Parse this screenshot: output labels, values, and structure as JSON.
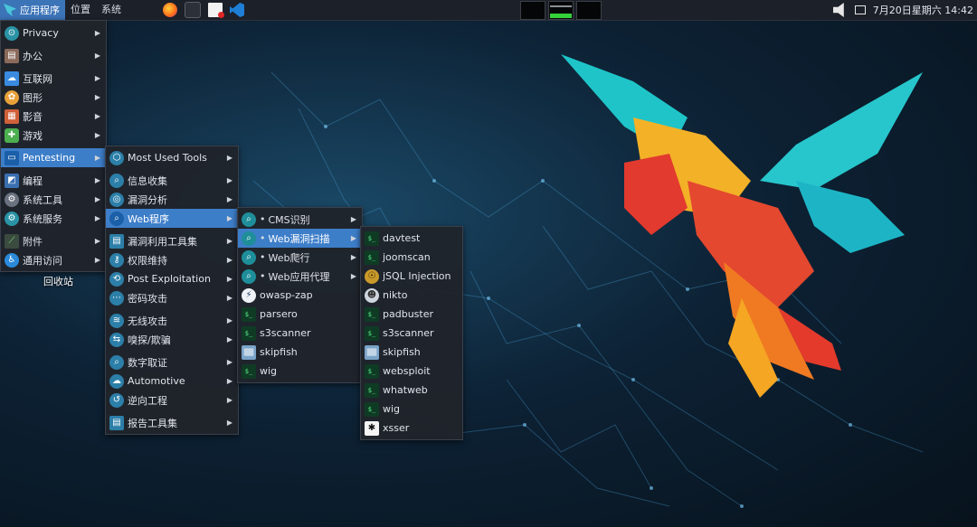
{
  "topbar": {
    "app_menu_label": "应用程序",
    "places_label": "位置",
    "system_label": "系统",
    "clock": "7月20日星期六 14:42"
  },
  "desktop": {
    "trash_label": "回收站"
  },
  "menus": {
    "main": [
      {
        "label": "Privacy",
        "icon": "privacy-icon"
      },
      {
        "label": "办公",
        "icon": "office-icon"
      },
      {
        "label": "互联网",
        "icon": "internet-icon"
      },
      {
        "label": "图形",
        "icon": "graphics-icon"
      },
      {
        "label": "影音",
        "icon": "multimedia-icon"
      },
      {
        "label": "游戏",
        "icon": "games-icon"
      },
      {
        "label": "Pentesting",
        "icon": "pentesting-icon"
      },
      {
        "label": "编程",
        "icon": "programming-icon"
      },
      {
        "label": "系统工具",
        "icon": "system-tools-icon"
      },
      {
        "label": "系统服务",
        "icon": "system-services-icon"
      },
      {
        "label": "附件",
        "icon": "accessories-icon"
      },
      {
        "label": "通用访问",
        "icon": "accessibility-icon"
      }
    ],
    "pentesting": [
      {
        "label": "Most Used Tools"
      },
      {
        "label": "信息收集"
      },
      {
        "label": "漏洞分析"
      },
      {
        "label": "Web程序"
      },
      {
        "label": "漏洞利用工具集"
      },
      {
        "label": "权限维持"
      },
      {
        "label": "Post Exploitation"
      },
      {
        "label": "密码攻击"
      },
      {
        "label": "无线攻击"
      },
      {
        "label": "嗅探/欺骗"
      },
      {
        "label": "数字取证"
      },
      {
        "label": "Automotive"
      },
      {
        "label": "逆向工程"
      },
      {
        "label": "报告工具集"
      }
    ],
    "web": [
      {
        "label": "CMS识别"
      },
      {
        "label": "Web漏洞扫描"
      },
      {
        "label": "Web爬行"
      },
      {
        "label": "Web应用代理"
      },
      {
        "label": "owasp-zap"
      },
      {
        "label": "parsero"
      },
      {
        "label": "s3scanner"
      },
      {
        "label": "skipfish"
      },
      {
        "label": "wig"
      }
    ],
    "vuln_scan": [
      {
        "label": "davtest"
      },
      {
        "label": "joomscan"
      },
      {
        "label": "jSQL Injection"
      },
      {
        "label": "nikto"
      },
      {
        "label": "padbuster"
      },
      {
        "label": "s3scanner"
      },
      {
        "label": "skipfish"
      },
      {
        "label": "websploit"
      },
      {
        "label": "whatweb"
      },
      {
        "label": "wig"
      },
      {
        "label": "xsser"
      }
    ]
  }
}
